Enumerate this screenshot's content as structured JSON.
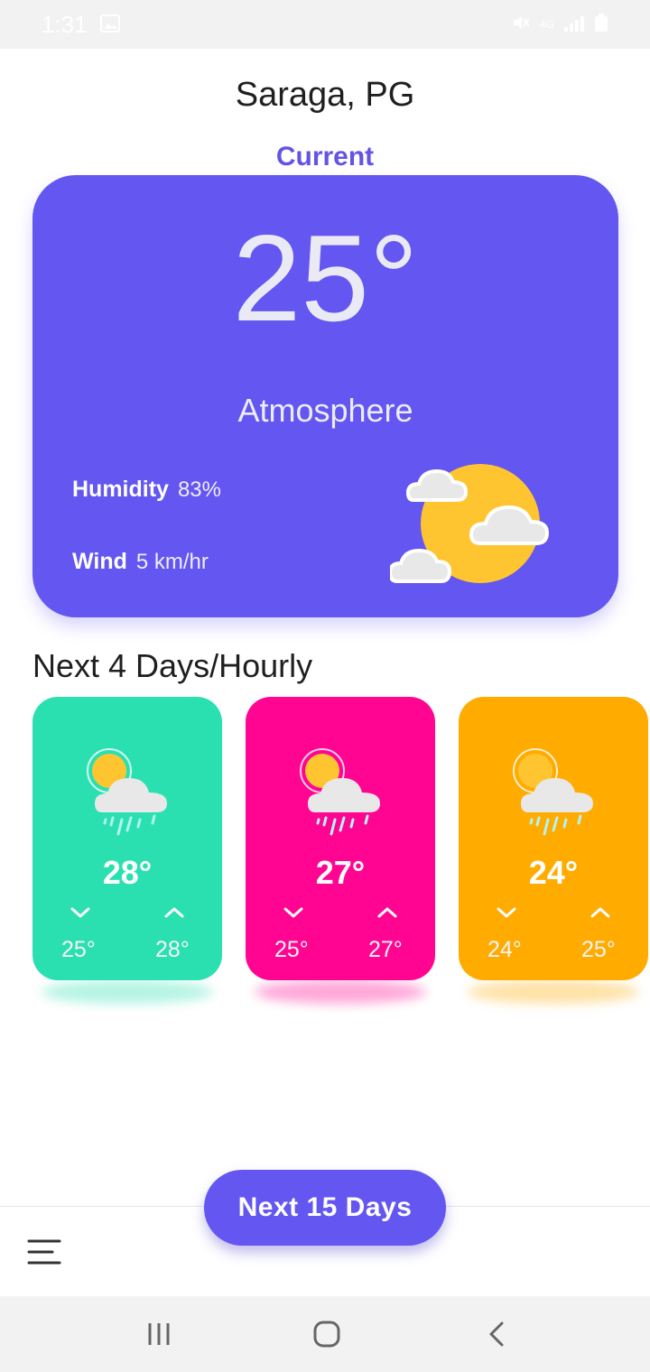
{
  "status_bar": {
    "time": "1:31",
    "network": "4G"
  },
  "header": {
    "city": "Saraga, PG",
    "current_label": "Current"
  },
  "current": {
    "temperature": "25°",
    "condition": "Atmosphere",
    "humidity_label": "Humidity",
    "humidity_value": "83%",
    "wind_label": "Wind",
    "wind_value": "5 km/hr"
  },
  "forecast": {
    "title": "Next 4 Days/Hourly",
    "cards": [
      {
        "temp": "28°",
        "min": "25°",
        "max": "28°",
        "color": "#2be0b0"
      },
      {
        "temp": "27°",
        "min": "25°",
        "max": "27°",
        "color": "#ff0591"
      },
      {
        "temp": "24°",
        "min": "24°",
        "max": "25°",
        "color": "#ffab00"
      }
    ]
  },
  "bottom": {
    "next_button_label": "Next 15 Days"
  },
  "colors": {
    "primary": "#6456f0",
    "sun": "#ffc530",
    "cloud": "#e8e8e8"
  }
}
